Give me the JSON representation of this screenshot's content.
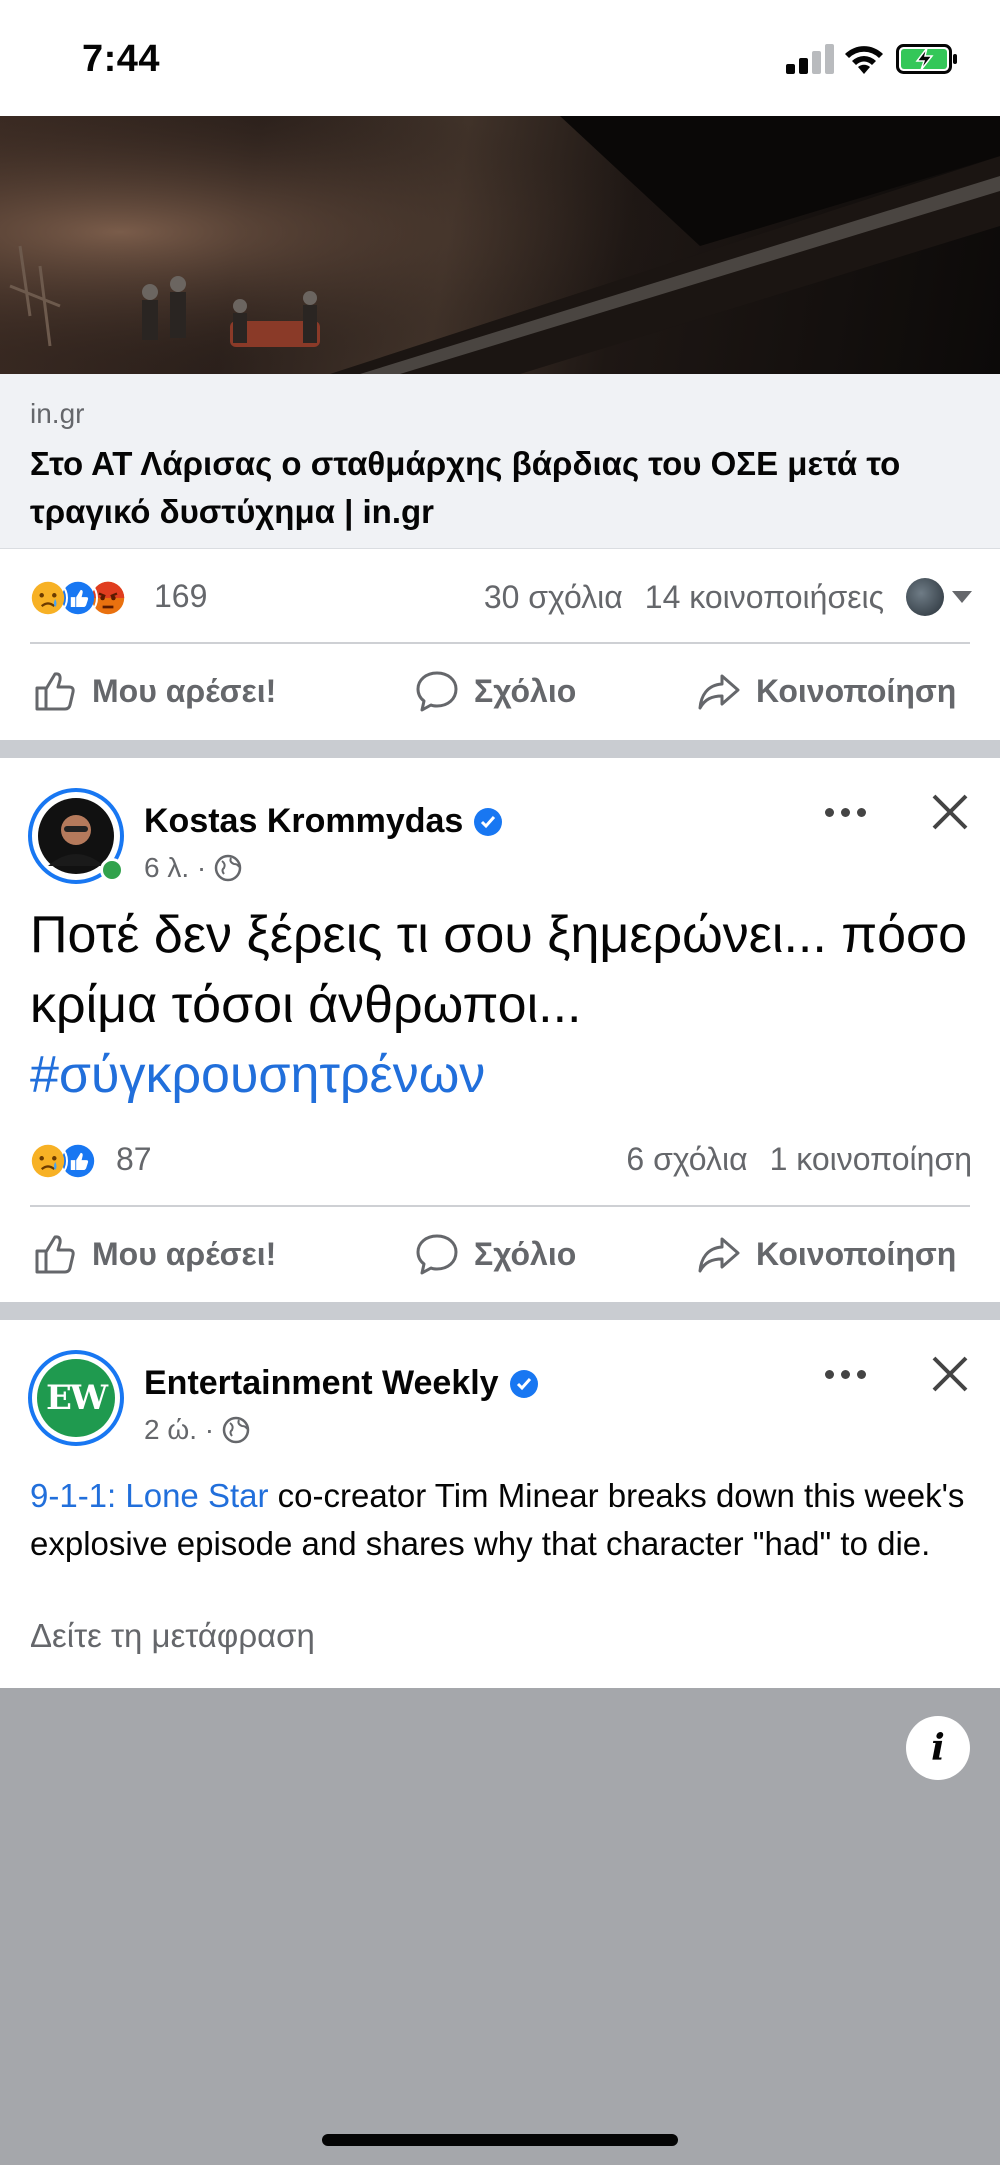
{
  "status_bar": {
    "time": "7:44"
  },
  "post1": {
    "link_domain": "in.gr",
    "link_title": "Στο ΑΤ Λάρισας ο σταθμάρχης βάρδιας του ΟΣΕ μετά το τραγικό δυστύχημα | in.gr",
    "reactions_count": "169",
    "comments": "30 σχόλια",
    "shares": "14 κοινοποιήσεις"
  },
  "actions": {
    "like": "Μου αρέσει!",
    "comment": "Σχόλιο",
    "share": "Κοινοποίηση"
  },
  "post2": {
    "author": "Kostas Krommydas",
    "time": "6 λ. ·",
    "text": "Ποτέ δεν ξέρεις τι σου ξημερώνει... πόσο κρίμα τόσοι άνθρωποι...",
    "hashtag": "#σύγκρουσητρένων",
    "reactions_count": "87",
    "comments": "6 σχόλια",
    "shares": "1 κοινοποίηση"
  },
  "post3": {
    "author": "Entertainment Weekly",
    "avatar_text": "EW",
    "time": "2 ώ. ·",
    "link_text": "9-1-1: Lone Star",
    "text": " co-creator Tim Minear breaks down this week's explosive episode and shares why that character \"had\" to die.",
    "see_translation": "Δείτε τη μετάφραση",
    "info_label": "i"
  },
  "colors": {
    "facebook_blue": "#1877f2",
    "link_blue": "#216fdb",
    "secondary_text": "#65676b",
    "online_green": "#31a24c",
    "ew_green": "#1f9a4f"
  },
  "icons": [
    "sad-reaction-icon",
    "like-reaction-icon",
    "angry-reaction-icon",
    "thumbs-up-icon",
    "comment-icon",
    "share-icon",
    "verified-icon",
    "globe-icon",
    "more-icon",
    "close-icon",
    "info-icon"
  ]
}
